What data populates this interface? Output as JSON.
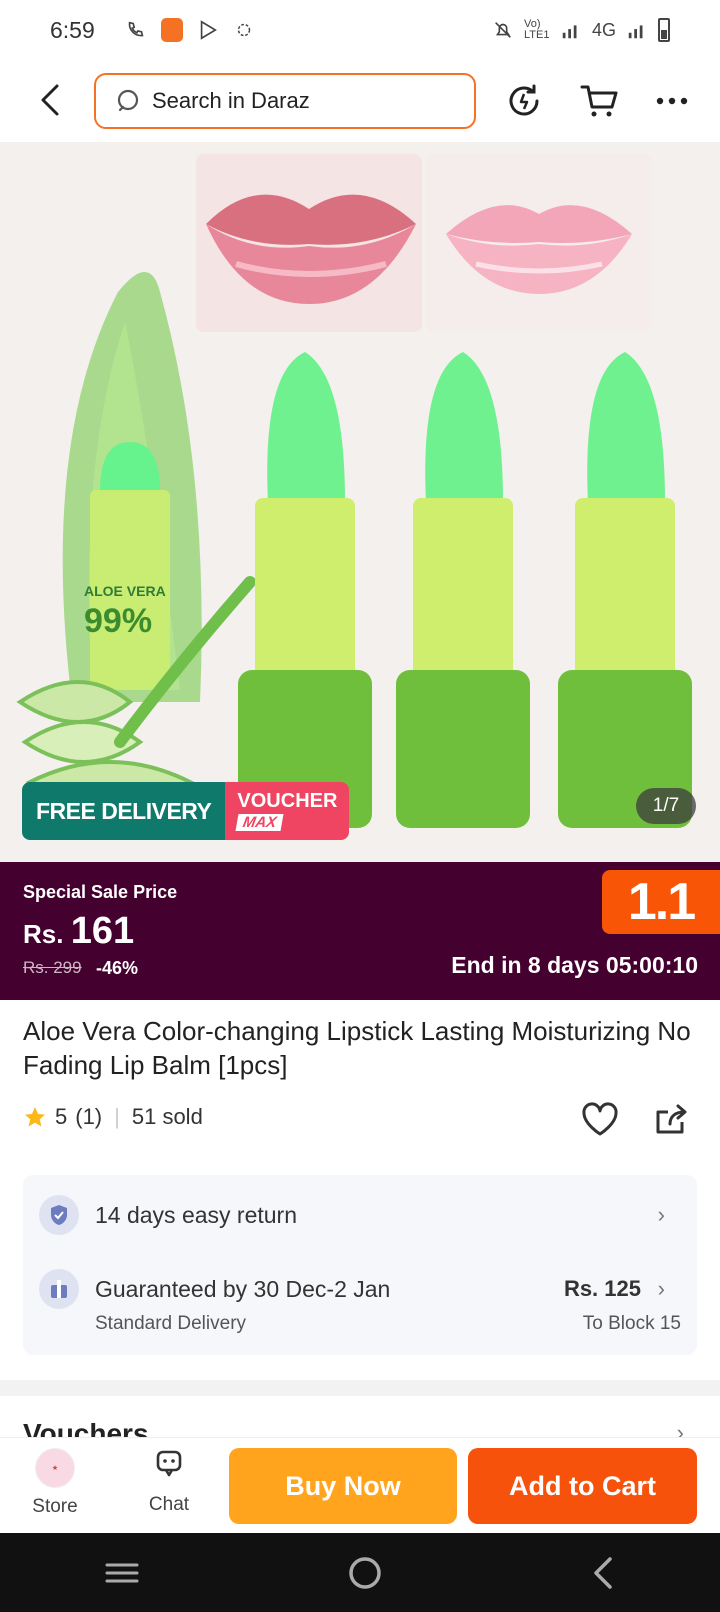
{
  "status_bar": {
    "time": "6:59",
    "network": "4G",
    "volte": "Vo) LTE1"
  },
  "header": {
    "search_placeholder": "Search in Daraz"
  },
  "gallery": {
    "image_counter": "1/7",
    "free_delivery": "FREE DELIVERY",
    "voucher": "VOUCHER",
    "voucher_max": "MAX",
    "product_text": "ALOE VERA",
    "product_percent": "99%"
  },
  "sale": {
    "label": "Special Sale Price",
    "currency": "Rs.",
    "price": "161",
    "old_price": "Rs. 299",
    "discount": "-46%",
    "ends": "End in 8 days 05:00:10",
    "badge": "1.1"
  },
  "product": {
    "title": "Aloe Vera Color-changing Lipstick Lasting Moisturizing No Fading Lip Balm [1pcs]",
    "rating": "5",
    "reviews": "(1)",
    "sold": "51 sold"
  },
  "info": {
    "return_text": "14 days easy return",
    "delivery_text": "Guaranteed by 30 Dec-2 Jan",
    "delivery_type": "Standard Delivery",
    "delivery_price": "Rs. 125",
    "delivery_location": "To Block 15"
  },
  "vouchers_label": "Vouchers",
  "bottom": {
    "store": "Store",
    "chat": "Chat",
    "buy_now": "Buy Now",
    "add_to_cart": "Add to Cart"
  },
  "colors": {
    "brand": "#f57224",
    "sale_bg": "#44002f",
    "buy_now": "#ffa41c",
    "add_to_cart": "#f6520c"
  }
}
